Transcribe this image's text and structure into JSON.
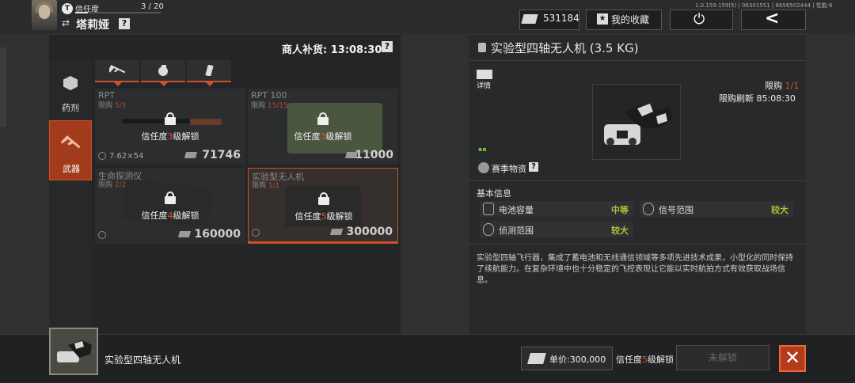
{
  "header": {
    "trust_badge": "T",
    "trust_label": "信任度",
    "trust_count": "3 / 20",
    "trust_progress": 0.15,
    "trader_name": "塔莉娅",
    "help": "?",
    "version": "1.0.159.159(5) | 06301551 | 8856502444 | 性能:6",
    "cash": "531184",
    "favorites": "我的收藏"
  },
  "left_panel": {
    "restock": "商人补货: 13:08:30",
    "help": "?",
    "categories": [
      {
        "label": "药剂",
        "active": false
      },
      {
        "label": "武器",
        "active": true
      }
    ],
    "items": [
      {
        "name": "RPT",
        "limit_prefix": "限购 ",
        "limit": "5/5",
        "unlock_prefix": "信任度",
        "level": "3",
        "unlock_suffix": "级解锁",
        "ammo": "7.62×54",
        "price": "71746"
      },
      {
        "name": "RPT 100",
        "limit_prefix": "限购 ",
        "limit": "15/15",
        "unlock_prefix": "信任度",
        "level": "3",
        "unlock_suffix": "级解锁",
        "price": "11000"
      },
      {
        "name": "生命探测仪",
        "limit_prefix": "限购 ",
        "limit": "2/2",
        "unlock_prefix": "信任度",
        "level": "4",
        "unlock_suffix": "级解锁",
        "price": "160000"
      },
      {
        "name": "实验型无人机",
        "limit_prefix": "限购 ",
        "limit": "1/1",
        "unlock_prefix": "信任度",
        "level": "5",
        "unlock_suffix": "级解锁",
        "price": "300000"
      }
    ]
  },
  "detail": {
    "title": "实验型四轴无人机 (3.5 KG)",
    "detail_label": "详情",
    "limit_prefix": "限购 ",
    "limit_value": "1/1",
    "refresh": "限购刷新 85:08:30",
    "season": "赛季物资",
    "help": "?",
    "basic_info": "基本信息",
    "stats": [
      {
        "name": "电池容量",
        "value": "中等"
      },
      {
        "name": "信号范围",
        "value": "较大"
      },
      {
        "name": "侦测范围",
        "value": "较大"
      }
    ],
    "description": "实验型四轴飞行器，集成了蓄电池和无线通信领域等多项先进技术成果，小型化的同时保持了续航能力。在复杂环境中也十分稳定的飞控表现让它能以实时航拍方式有效获取战场信息。"
  },
  "bottom": {
    "item_name": "实验型四轴无人机",
    "unit_price": "单价:300,000",
    "req_prefix": "信任度",
    "req_level": "5",
    "req_suffix": "级解锁",
    "locked": "未解锁",
    "close": "✕"
  }
}
